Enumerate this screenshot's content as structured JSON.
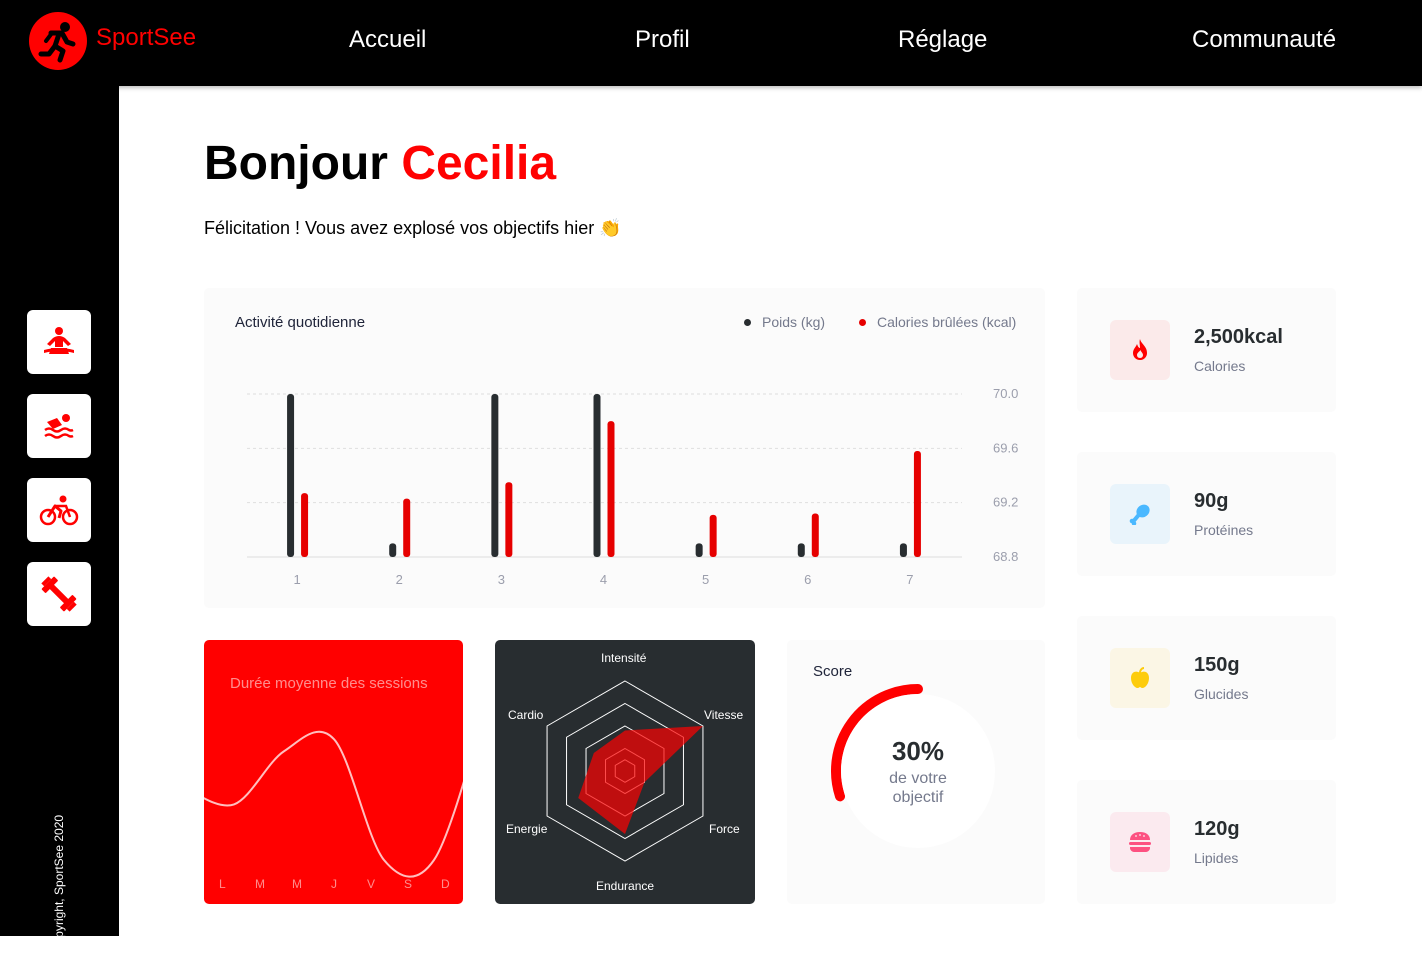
{
  "app": {
    "logo_text": "SportSee",
    "nav": [
      "Accueil",
      "Profil",
      "Réglage",
      "Communauté"
    ],
    "copyright": "Copyright, SportSee 2020"
  },
  "sidebar": {
    "icons": [
      "yoga-icon",
      "swimming-icon",
      "cycling-icon",
      "dumbbell-icon"
    ]
  },
  "header": {
    "greeting": "Bonjour",
    "name": "Cecilia",
    "message": "Félicitation ! Vous avez explosé vos objectifs hier 👏"
  },
  "colors": {
    "accent": "#ff0101",
    "dark": "#282d30",
    "muted": "#74798c"
  },
  "activity": {
    "title": "Activité quotidienne",
    "legend": [
      "Poids (kg)",
      "Calories brûlées (kcal)"
    ]
  },
  "sessions": {
    "title": "Durée moyenne des sessions",
    "days": [
      "L",
      "M",
      "M",
      "J",
      "V",
      "S",
      "D"
    ]
  },
  "score": {
    "title": "Score",
    "value": "30%",
    "text_1": "de votre",
    "text_2": "objectif",
    "fraction": 0.3
  },
  "key_data": [
    {
      "value": "2,500kcal",
      "label": "Calories",
      "icon": "flame-icon",
      "bg": "#fbeaea",
      "fg": "#ff0000"
    },
    {
      "value": "90g",
      "label": "Protéines",
      "icon": "chicken-leg-icon",
      "bg": "#e9f4fb",
      "fg": "#4ab8ff"
    },
    {
      "value": "150g",
      "label": "Glucides",
      "icon": "apple-icon",
      "bg": "#fbf6e5",
      "fg": "#fdcc0c"
    },
    {
      "value": "120g",
      "label": "Lipides",
      "icon": "burger-icon",
      "bg": "#fbeaef",
      "fg": "#fd5181"
    }
  ],
  "chart_data": [
    {
      "type": "bar",
      "title": "Activité quotidienne",
      "categories": [
        "1",
        "2",
        "3",
        "4",
        "5",
        "6",
        "7"
      ],
      "series": [
        {
          "name": "Poids (kg)",
          "values": [
            70.0,
            68.9,
            70.0,
            70.0,
            68.9,
            68.9,
            68.9
          ],
          "color": "#282d30"
        },
        {
          "name": "Calories brûlées (kcal)",
          "values": [
            69.27,
            69.23,
            69.35,
            69.8,
            69.11,
            69.12,
            69.58
          ],
          "color": "#e60000"
        }
      ],
      "y_ticks": [
        "70.0",
        "69.6",
        "69.2",
        "68.8"
      ],
      "ylim": [
        68.8,
        70.0
      ],
      "y_axis_side": "right",
      "grid": "horizontal dashed"
    },
    {
      "type": "line",
      "title": "Durée moyenne des sessions",
      "categories": [
        "L",
        "M",
        "M",
        "J",
        "V",
        "S",
        "D"
      ],
      "values": [
        30,
        23,
        45,
        50,
        0,
        0,
        60
      ],
      "color": "#ffffff"
    },
    {
      "type": "radar",
      "categories": [
        "Intensité",
        "Vitesse",
        "Force",
        "Endurance",
        "Energie",
        "Cardio"
      ],
      "values": [
        90,
        200,
        50,
        140,
        120,
        80
      ],
      "max": 200,
      "color": "#ff0101"
    },
    {
      "type": "pie",
      "title": "Score",
      "values": [
        30,
        70
      ],
      "labels": [
        "30%",
        ""
      ]
    }
  ]
}
